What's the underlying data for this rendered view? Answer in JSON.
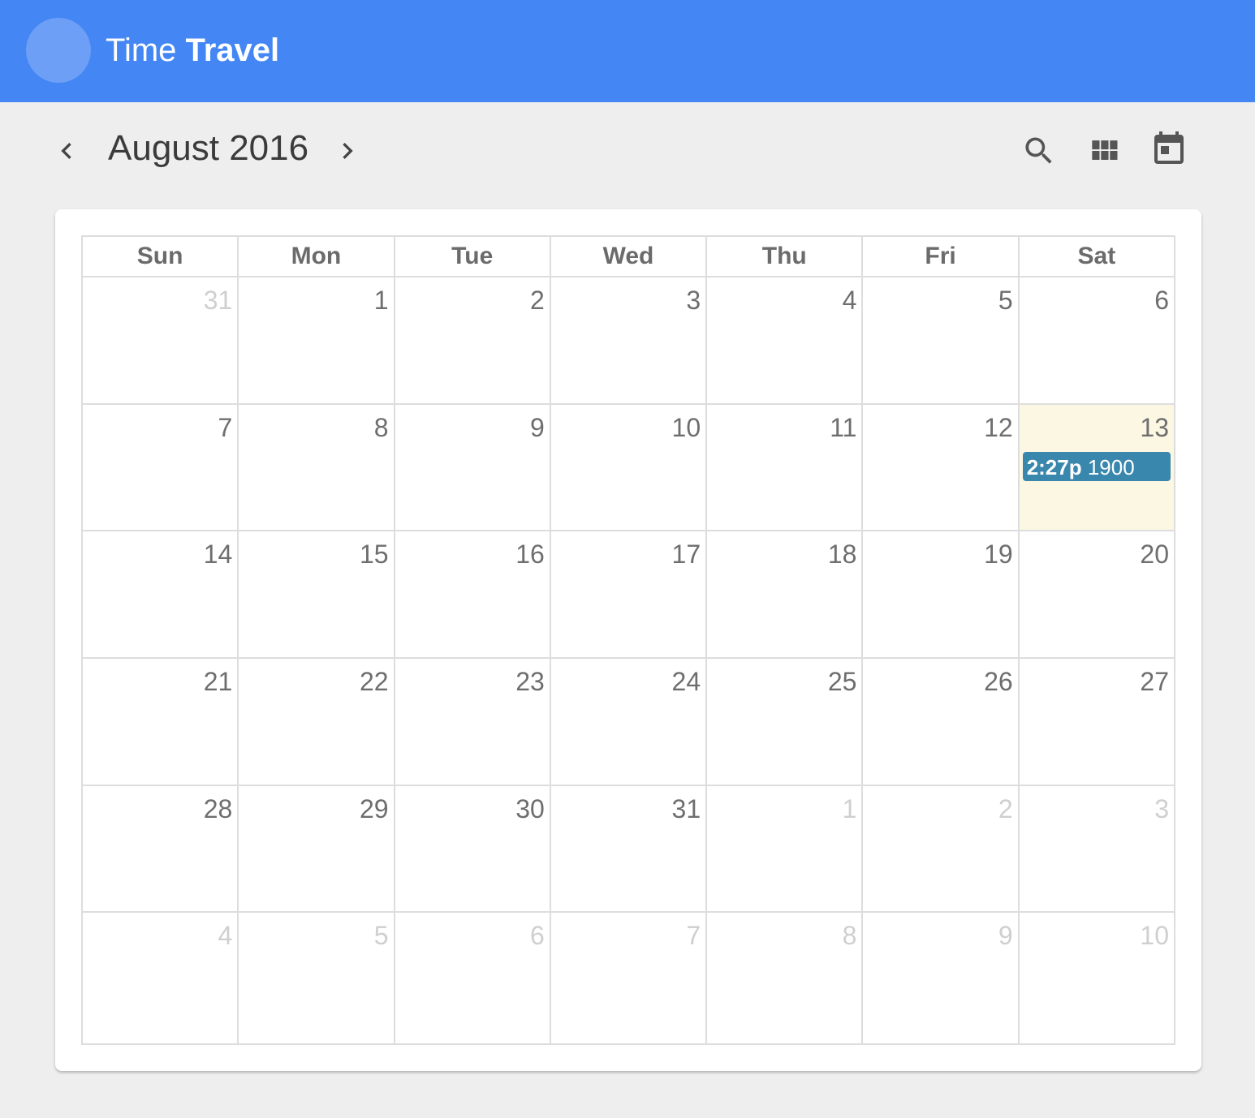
{
  "app": {
    "title_light": "Time ",
    "title_bold": "Travel"
  },
  "toolbar": {
    "month_label": "August 2016",
    "icons": [
      "chevron-left-icon",
      "chevron-right-icon",
      "search-icon",
      "month-view-icon",
      "calendar-today-icon"
    ]
  },
  "colors": {
    "appbar": "#4386f4",
    "event": "#3a87ad",
    "today": "#fcf7e3"
  },
  "calendar": {
    "weekdays": [
      "Sun",
      "Mon",
      "Tue",
      "Wed",
      "Thu",
      "Fri",
      "Sat"
    ],
    "weeks": [
      [
        {
          "d": "31",
          "o": true
        },
        {
          "d": "1"
        },
        {
          "d": "2"
        },
        {
          "d": "3"
        },
        {
          "d": "4"
        },
        {
          "d": "5"
        },
        {
          "d": "6"
        }
      ],
      [
        {
          "d": "7"
        },
        {
          "d": "8"
        },
        {
          "d": "9"
        },
        {
          "d": "10"
        },
        {
          "d": "11"
        },
        {
          "d": "12"
        },
        {
          "d": "13",
          "today": true,
          "event": {
            "time": "2:27p",
            "title": "1900"
          }
        }
      ],
      [
        {
          "d": "14"
        },
        {
          "d": "15"
        },
        {
          "d": "16"
        },
        {
          "d": "17"
        },
        {
          "d": "18"
        },
        {
          "d": "19"
        },
        {
          "d": "20"
        }
      ],
      [
        {
          "d": "21"
        },
        {
          "d": "22"
        },
        {
          "d": "23"
        },
        {
          "d": "24"
        },
        {
          "d": "25"
        },
        {
          "d": "26"
        },
        {
          "d": "27"
        }
      ],
      [
        {
          "d": "28"
        },
        {
          "d": "29"
        },
        {
          "d": "30"
        },
        {
          "d": "31"
        },
        {
          "d": "1",
          "o": true
        },
        {
          "d": "2",
          "o": true
        },
        {
          "d": "3",
          "o": true
        }
      ],
      [
        {
          "d": "4",
          "o": true
        },
        {
          "d": "5",
          "o": true
        },
        {
          "d": "6",
          "o": true
        },
        {
          "d": "7",
          "o": true
        },
        {
          "d": "8",
          "o": true
        },
        {
          "d": "9",
          "o": true
        },
        {
          "d": "10",
          "o": true
        }
      ]
    ]
  }
}
